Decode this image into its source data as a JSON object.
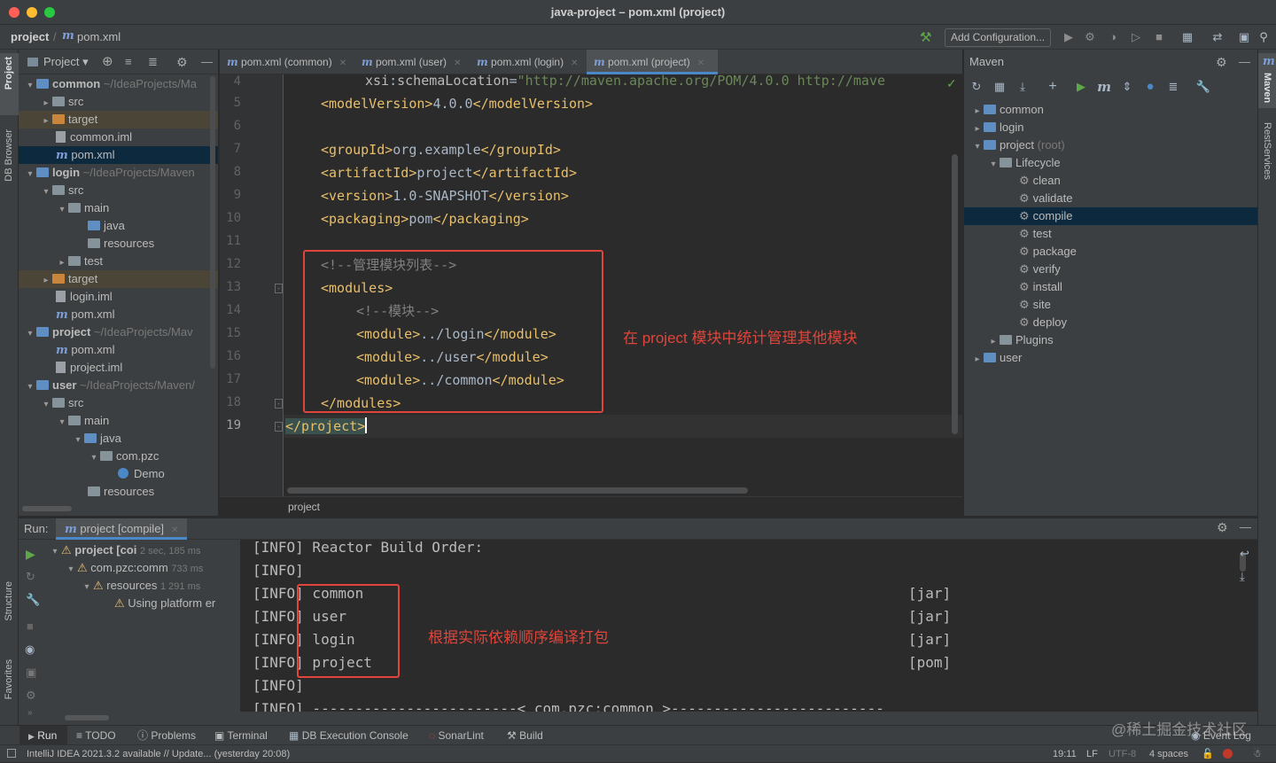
{
  "window": {
    "title": "java-project – pom.xml (project)"
  },
  "nav": {
    "project": "project",
    "file": "pom.xml",
    "add_config": "Add Configuration..."
  },
  "left_strip": {
    "project": "Project",
    "db_browser": "DB Browser",
    "structure": "Structure",
    "favorites": "Favorites"
  },
  "right_strip": {
    "maven": "Maven",
    "rest": "RestServices"
  },
  "project_panel": {
    "title": "Project",
    "tree": [
      {
        "label": "common",
        "path": "~/IdeaProjects/Ma"
      },
      {
        "label": "src"
      },
      {
        "label": "target"
      },
      {
        "label": "common.iml"
      },
      {
        "label": "pom.xml"
      },
      {
        "label": "login",
        "path": "~/IdeaProjects/Maven"
      },
      {
        "label": "src"
      },
      {
        "label": "main"
      },
      {
        "label": "java"
      },
      {
        "label": "resources"
      },
      {
        "label": "test"
      },
      {
        "label": "target"
      },
      {
        "label": "login.iml"
      },
      {
        "label": "pom.xml"
      },
      {
        "label": "project",
        "path": "~/IdeaProjects/Mav"
      },
      {
        "label": "pom.xml"
      },
      {
        "label": "project.iml"
      },
      {
        "label": "user",
        "path": "~/IdeaProjects/Maven/"
      },
      {
        "label": "src"
      },
      {
        "label": "main"
      },
      {
        "label": "java"
      },
      {
        "label": "com.pzc"
      },
      {
        "label": "Demo"
      },
      {
        "label": "resources"
      }
    ]
  },
  "editor": {
    "tabs": [
      {
        "label": "pom.xml (common)"
      },
      {
        "label": "pom.xml (user)"
      },
      {
        "label": "pom.xml (login)"
      },
      {
        "label": "pom.xml (project)"
      }
    ],
    "line_numbers": [
      "4",
      "5",
      "6",
      "7",
      "8",
      "9",
      "10",
      "11",
      "12",
      "13",
      "14",
      "15",
      "16",
      "17",
      "18",
      "19"
    ],
    "lines": {
      "l4_attr": "xsi",
      "l4_colon": ":",
      "l4_attr2": "schemaLocation",
      "l4_eq": "=",
      "l4_val": "\"http://maven.apache.org/POM/4.0.0 http://mave",
      "l5_open": "<modelVersion>",
      "l5_text": "4.0.0",
      "l5_close": "</modelVersion>",
      "l7_open": "<groupId>",
      "l7_text": "org.example",
      "l7_close": "</groupId>",
      "l8_open": "<artifactId>",
      "l8_text": "project",
      "l8_close": "</artifactId>",
      "l9_open": "<version>",
      "l9_text": "1.0-SNAPSHOT",
      "l9_close": "</version>",
      "l10_open": "<packaging>",
      "l10_text": "pom",
      "l10_close": "</packaging>",
      "l12_comment": "<!--管理模块列表-->",
      "l13_open": "<modules>",
      "l14_comment": "<!--模块-->",
      "l15_open": "<module>",
      "l15_text": "../login",
      "l15_close": "</module>",
      "l16_open": "<module>",
      "l16_text": "../user",
      "l16_close": "</module>",
      "l17_open": "<module>",
      "l17_text": "../common",
      "l17_close": "</module>",
      "l18_close": "</modules>",
      "l19_close": "</project>"
    },
    "breadcrumb": "project"
  },
  "annotations": {
    "editor": "在 project 模块中统计管理其他模块",
    "console": "根据实际依赖顺序编译打包"
  },
  "maven_panel": {
    "title": "Maven",
    "items": [
      {
        "label": "common"
      },
      {
        "label": "login"
      },
      {
        "label": "project",
        "suffix": "(root)"
      },
      {
        "label": "Lifecycle"
      },
      {
        "label": "clean"
      },
      {
        "label": "validate"
      },
      {
        "label": "compile"
      },
      {
        "label": "test"
      },
      {
        "label": "package"
      },
      {
        "label": "verify"
      },
      {
        "label": "install"
      },
      {
        "label": "site"
      },
      {
        "label": "deploy"
      },
      {
        "label": "Plugins"
      },
      {
        "label": "user"
      }
    ]
  },
  "run_panel": {
    "label": "Run:",
    "tab": "project [compile]",
    "tree": [
      {
        "label": "project [coi",
        "time": "2 sec, 185 ms"
      },
      {
        "label": "com.pzc:comm",
        "time": "733 ms"
      },
      {
        "label": "resources",
        "time": "1 291 ms"
      },
      {
        "label": "Using platform er"
      }
    ],
    "console": [
      {
        "prefix": "[INFO]",
        "text": " Reactor Build Order:",
        "type": ""
      },
      {
        "prefix": "[INFO]",
        "text": "",
        "type": ""
      },
      {
        "prefix": "[INFO]",
        "text": " common",
        "type": "[jar]"
      },
      {
        "prefix": "[INFO]",
        "text": " user",
        "type": "[jar]"
      },
      {
        "prefix": "[INFO]",
        "text": " login",
        "type": "[jar]"
      },
      {
        "prefix": "[INFO]",
        "text": " project",
        "type": "[pom]"
      },
      {
        "prefix": "[INFO]",
        "text": "",
        "type": ""
      },
      {
        "prefix": "[INFO]",
        "text": " ------------------------< com.pzc:common >-------------------------",
        "type": ""
      }
    ]
  },
  "bottom_tabs": [
    {
      "label": "Run"
    },
    {
      "label": "TODO"
    },
    {
      "label": "Problems"
    },
    {
      "label": "Terminal"
    },
    {
      "label": "DB Execution Console"
    },
    {
      "label": "SonarLint"
    },
    {
      "label": "Build"
    }
  ],
  "event_log": "Event Log",
  "watermark": "@稀土掘金技术社区",
  "status": {
    "message": "IntelliJ IDEA 2021.3.2 available // Update... (yesterday 20:08)",
    "position": "19:11",
    "line_sep": "LF",
    "encoding": "UTF-8",
    "indent": "4 spaces"
  },
  "colors": {
    "accent": "#4a88c7",
    "annotation": "#e0443a",
    "tag": "#e8bf6a",
    "comment": "#808080"
  }
}
